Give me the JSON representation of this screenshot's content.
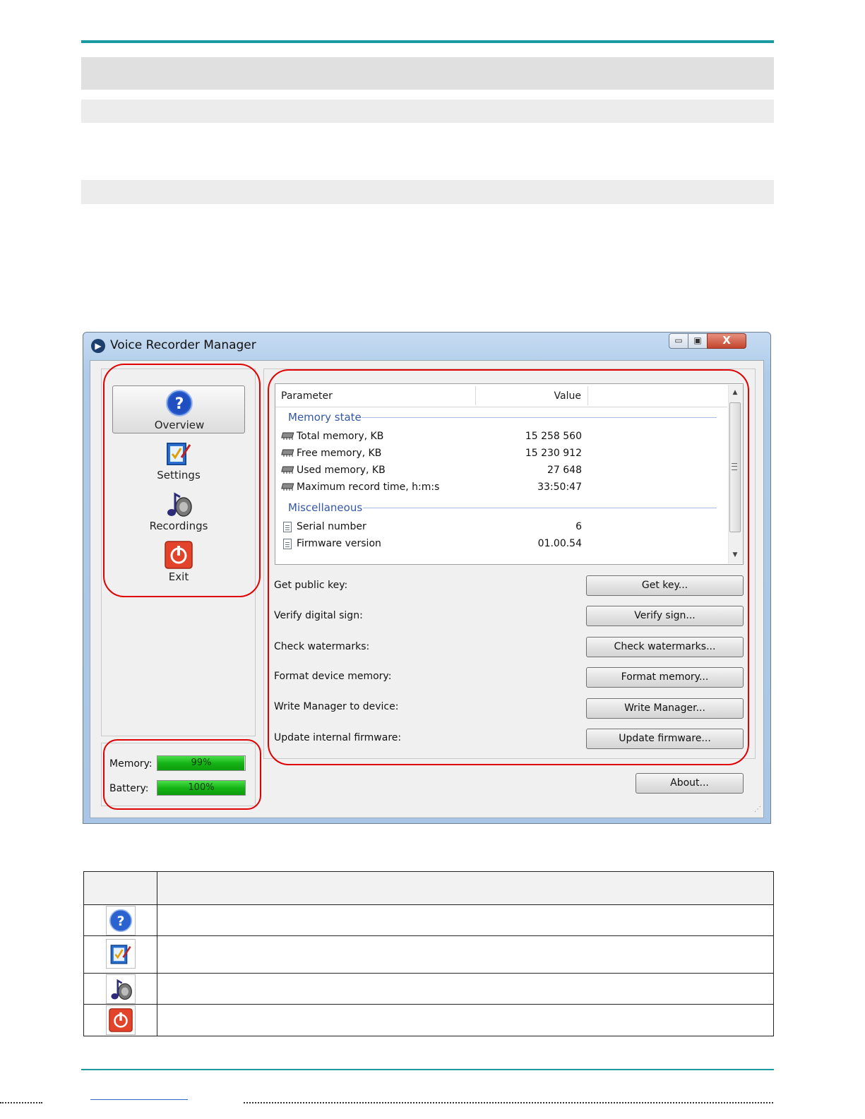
{
  "window": {
    "title": "Voice Recorder Manager",
    "controls": {
      "minimize": "▭",
      "maximize": "▣",
      "close": "X"
    }
  },
  "nav": {
    "items": [
      {
        "label": "Overview",
        "icon": "help-icon",
        "selected": true
      },
      {
        "label": "Settings",
        "icon": "settings-icon",
        "selected": false
      },
      {
        "label": "Recordings",
        "icon": "recordings-icon",
        "selected": false
      },
      {
        "label": "Exit",
        "icon": "power-icon",
        "selected": false
      }
    ]
  },
  "status": {
    "memory": {
      "label": "Memory:",
      "value_text": "99%",
      "fraction": 0.99
    },
    "battery": {
      "label": "Battery:",
      "value_text": "100%",
      "fraction": 1.0
    }
  },
  "table": {
    "columns": {
      "parameter": "Parameter",
      "value": "Value"
    },
    "groups": [
      {
        "name": "Memory state",
        "rows": [
          {
            "icon": "memory-chip-icon",
            "label": "Total memory, KB",
            "value": "15 258 560"
          },
          {
            "icon": "memory-chip-icon",
            "label": "Free memory, KB",
            "value": "15 230 912"
          },
          {
            "icon": "memory-chip-icon",
            "label": "Used memory, KB",
            "value": "27 648"
          },
          {
            "icon": "memory-chip-icon",
            "label": "Maximum record time, h:m:s",
            "value": "33:50:47"
          }
        ]
      },
      {
        "name": "Miscellaneous",
        "rows": [
          {
            "icon": "document-icon",
            "label": "Serial number",
            "value": "6"
          },
          {
            "icon": "document-icon",
            "label": "Firmware version",
            "value": "01.00.54"
          }
        ]
      }
    ]
  },
  "actions": [
    {
      "label": "Get public key:",
      "button": "Get key..."
    },
    {
      "label": "Verify digital sign:",
      "button": "Verify sign..."
    },
    {
      "label": "Check watermarks:",
      "button": "Check watermarks..."
    },
    {
      "label": "Format device memory:",
      "button": "Format memory..."
    },
    {
      "label": "Write Manager to device:",
      "button": "Write Manager..."
    },
    {
      "label": "Update internal firmware:",
      "button": "Update firmware..."
    }
  ],
  "about_button": "About...",
  "colors": {
    "highlight": "#e00000",
    "accent_rule": "#1a9aa0",
    "group_text": "#3457a8",
    "progress_green": "#17b417"
  },
  "legend_icons": [
    "help-icon",
    "settings-icon",
    "recordings-icon",
    "power-icon"
  ]
}
